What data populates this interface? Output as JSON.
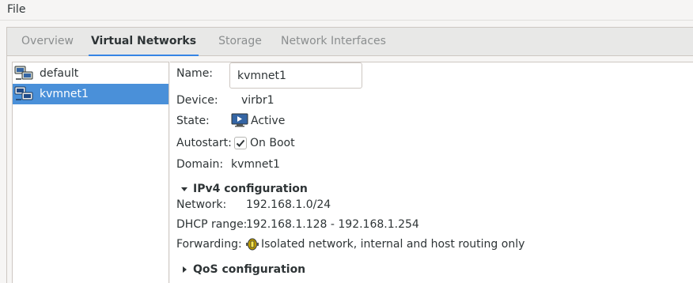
{
  "menubar": {
    "file": "File"
  },
  "tabs": [
    {
      "label": "Overview"
    },
    {
      "label": "Virtual Networks"
    },
    {
      "label": "Storage"
    },
    {
      "label": "Network Interfaces"
    }
  ],
  "active_tab": "Virtual Networks",
  "networks": [
    {
      "name": "default",
      "selected": false
    },
    {
      "name": "kvmnet1",
      "selected": true
    }
  ],
  "details": {
    "name_label": "Name:",
    "name_value": "kvmnet1",
    "device_label": "Device:",
    "device_value": "virbr1",
    "state_label": "State:",
    "state_value": "Active",
    "state_icon": "play-monitor-icon",
    "autostart_label": "Autostart:",
    "autostart_value": "On Boot",
    "autostart_checked": true,
    "domain_label": "Domain:",
    "domain_value": "kvmnet1"
  },
  "ipv4": {
    "header": "IPv4 configuration",
    "expanded": true,
    "network_label": "Network:",
    "network_value": "192.168.1.0/24",
    "dhcp_label": "DHCP range:",
    "dhcp_value": "192.168.1.128 - 192.168.1.254",
    "forwarding_label": "Forwarding:",
    "forwarding_value": "Isolated network, internal and host routing only",
    "forwarding_icon": "isolated-network-icon"
  },
  "qos": {
    "header": "QoS configuration",
    "expanded": false
  },
  "colors": {
    "accent": "#3584e4",
    "selection": "#4a90d9",
    "background": "#f6f5f4"
  }
}
